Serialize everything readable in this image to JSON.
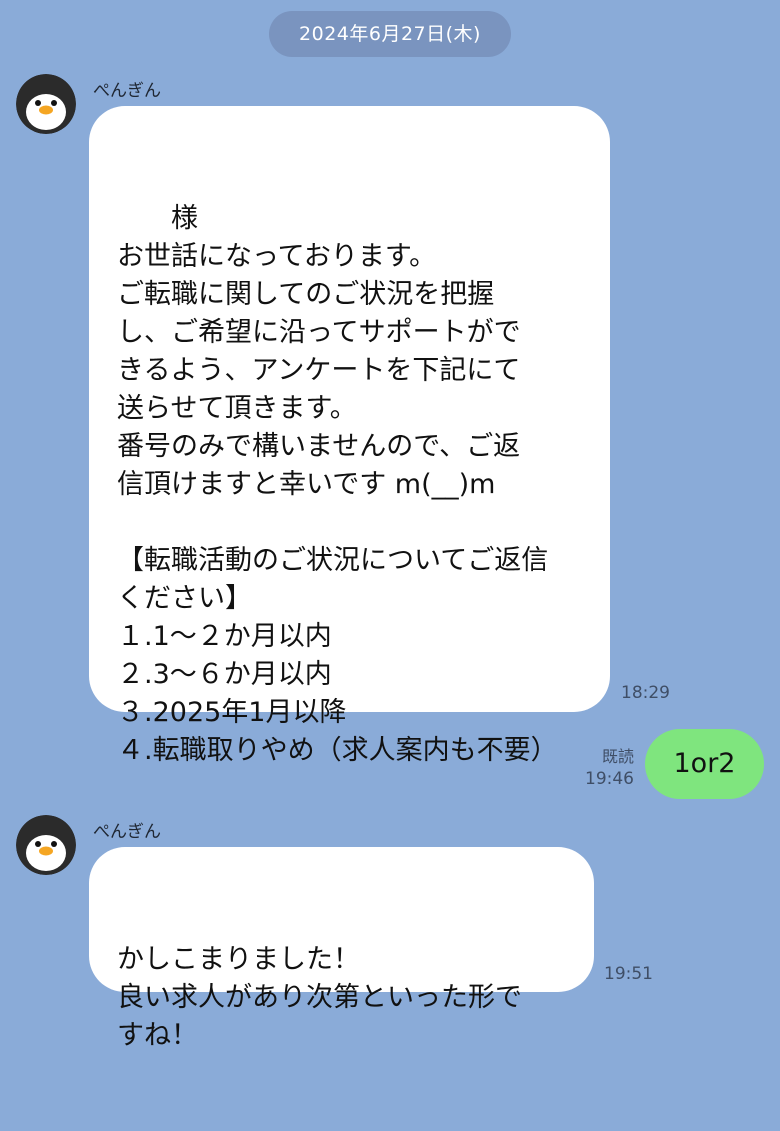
{
  "date_separator": "2024年6月27日(木)",
  "messages": [
    {
      "sender": "ぺんぎん",
      "avatar_icon": "penguin-icon",
      "text": "　　様\nお世話になっております。\nご転職に関してのご状況を把握\nし、ご希望に沿ってサポートがで\nきるよう、アンケートを下記にて\n送らせて頂きます。\n番号のみで構いませんので、ご返\n信頂けますと幸いです m(__)m\n\n【転職活動のご状況についてご返信\nください】\n１.1～２か月以内\n２.3～６か月以内\n３.2025年1月以降\n４.転職取りやめ（求人案内も不要）",
      "time": "18:29"
    },
    {
      "sender": "me",
      "text": "1or2",
      "read_label": "既読",
      "time": "19:46",
      "bubble_color": "#7fe57e"
    },
    {
      "sender": "ぺんぎん",
      "avatar_icon": "penguin-icon",
      "text": "かしこまりました！\n良い求人があり次第といった形で\nすね！",
      "time": "19:51"
    }
  ],
  "colors": {
    "background": "#8aabd8",
    "incoming_bubble": "#ffffff",
    "outgoing_bubble": "#7fe57e",
    "date_pill": "#7a94bf"
  }
}
